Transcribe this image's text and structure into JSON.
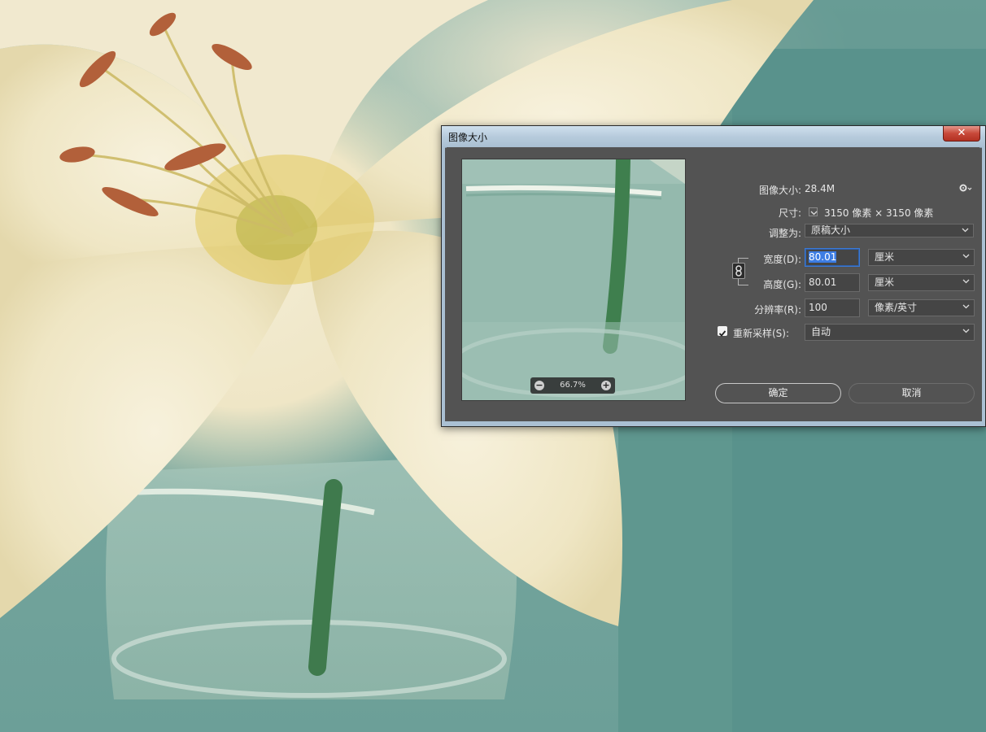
{
  "dialog": {
    "title": "图像大小",
    "close_label": "✕",
    "image_size_label": "图像大小:",
    "image_size_value": "28.4M",
    "dimensions_label": "尺寸:",
    "dimensions_value": "3150 像素 × 3150 像素",
    "fit_to_label": "调整为:",
    "fit_to_value": "原稿大小",
    "width_label": "宽度(D):",
    "width_value": "80.01",
    "width_unit": "厘米",
    "height_label": "高度(G):",
    "height_value": "80.01",
    "height_unit": "厘米",
    "resolution_label": "分辨率(R):",
    "resolution_value": "100",
    "resolution_unit": "像素/英寸",
    "resample_label": "重新采样(S):",
    "resample_checked": true,
    "resample_value": "自动",
    "ok_label": "确定",
    "cancel_label": "取消",
    "preview_zoom": "66.7%",
    "zoom_minus": "−",
    "zoom_plus": "+"
  },
  "icons": {
    "close": "close-icon",
    "gear": "gear-icon",
    "chevron": "chevron-down-icon",
    "link": "chain-link-icon",
    "check": "checkmark-icon",
    "zoom_in": "zoom-in-icon",
    "zoom_out": "zoom-out-icon"
  },
  "colors": {
    "dialog_bg": "#535353",
    "titlebar": "#b7cbdc",
    "close_button": "#c8493a",
    "focus": "#3b7ad6"
  }
}
